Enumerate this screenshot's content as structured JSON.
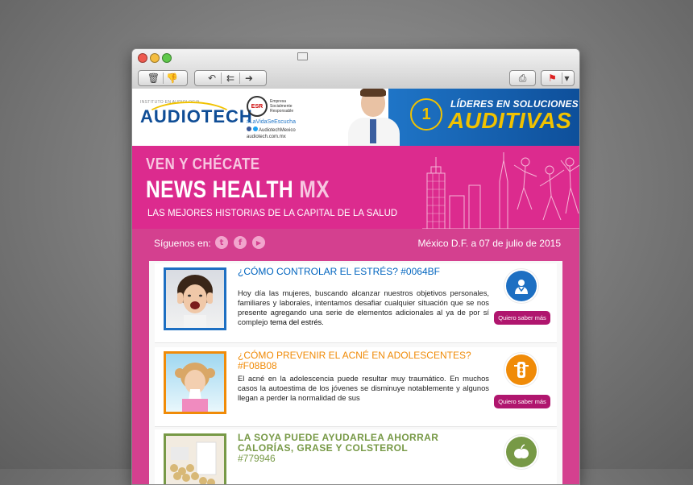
{
  "toolbar": {
    "delete_icon": "trash-icon",
    "junk_icon": "thumbs-down-icon",
    "reply_icon": "reply-arrow-icon",
    "reply_all_icon": "reply-all-arrow-icon",
    "forward_icon": "forward-arrow-icon",
    "print_icon": "printer-icon",
    "flag_icon": "flag-icon"
  },
  "banner": {
    "logo_tagline": "INSTITUTO EN AUDIOLOGIA",
    "logo_name": "AUDIOTECH",
    "esr_badge": "ESR",
    "esr_line1": "Empresa",
    "esr_line2": "Socialmente",
    "esr_line3": "Responsable",
    "hashtag": "#LaVidaSeEscucha",
    "social_handle": "AudiotechMexico",
    "website": "audiotech.com.mx",
    "rank": "1",
    "tagline_top": "LÍDERES EN SOLUCIONES",
    "tagline_bottom": "AUDITIVAS"
  },
  "hero": {
    "kicker": "VEN Y CHÉCATE",
    "title_main": "NEWS HEALTH ",
    "title_accent": "MX",
    "subtitle": "LAS MEJORES HISTORIAS DE LA CAPITAL DE LA SALUD"
  },
  "social": {
    "follow_label": "Síguenos en:",
    "twitter": "t",
    "facebook": "f",
    "youtube": "▶",
    "date": "México D.F. a 07  de julio de 2015"
  },
  "articles": [
    {
      "title": "¿CÓMO CONTROLAR EL ESTRÉS?  #0064BF",
      "title_color": "#0064BF",
      "body": "Hoy día las mujeres, buscando alcanzar nuestros objetivos personales, familiares y laborales, intentamos desafiar cualquier situación que se nos presente agregando una serie de elementos adicionales al ya de por sí complejo ",
      "body_link": "tema del estrés",
      "body_end": ".",
      "button": "Quiero saber más",
      "icon": "doctor-icon",
      "icon_color": "#1d6fc2"
    },
    {
      "title": "¿CÓMO PREVENIR EL ACNÉ EN ADOLESCENTES? #F08B08",
      "title_color": "#F08B08",
      "body": "El acné en la adolescencia puede resultar muy traumático. En muchos casos la autoestima de los jóvenes se disminuye notablemente y algunos llegan a perder la normalidad de sus",
      "button": "Quiero saber más",
      "icon": "traffic-light-icon",
      "icon_color": "#f08b08"
    },
    {
      "title": "LA SOYA PUEDE AYUDARLEA AHORRAR CALORÍAS, GRASE Y COLSTEROL",
      "code": "#779946",
      "title_color": "#779946",
      "icon": "apple-icon",
      "icon_color": "#779946"
    }
  ]
}
